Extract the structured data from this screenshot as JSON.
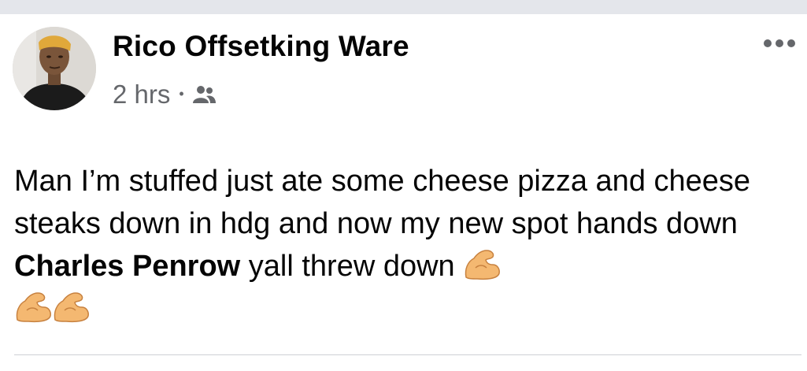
{
  "post": {
    "author": "Rico Offsetking Ware",
    "time": "2 hrs",
    "separator": "•",
    "audience_icon": "friends-icon",
    "more_icon": "more-options-icon",
    "text_part1": "Man I’m stuffed just ate some cheese pizza and cheese steaks down in hdg and now my new spot hands down ",
    "mention": "Charles Penrow",
    "text_part2": " yall threw down ",
    "emoji_count": 3,
    "emoji_name": "flexed-biceps-emoji"
  },
  "colors": {
    "strip": "#e4e6eb",
    "primary_text": "#050505",
    "secondary_text": "#65676b",
    "emoji_skin": "#f4b871",
    "emoji_outline": "#c7813f"
  }
}
